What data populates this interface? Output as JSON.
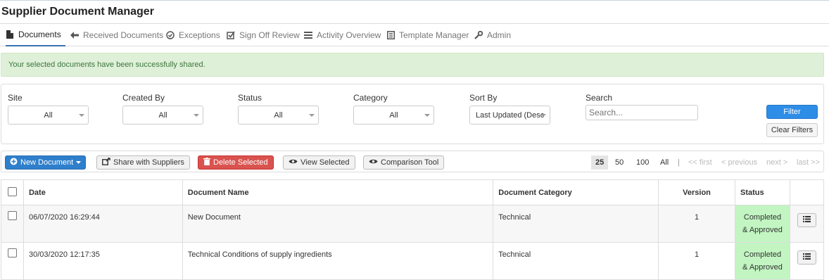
{
  "app": {
    "title": "Supplier Document Manager"
  },
  "tabs": [
    {
      "label": "Documents",
      "icon": "document-icon",
      "active": true
    },
    {
      "label": "Received Documents",
      "icon": "arrow-left-icon"
    },
    {
      "label": "Exceptions",
      "icon": "check-circle-icon"
    },
    {
      "label": "Sign Off Review",
      "icon": "check-square-icon"
    },
    {
      "label": "Activity Overview",
      "icon": "list-icon"
    },
    {
      "label": "Template Manager",
      "icon": "template-icon"
    },
    {
      "label": "Admin",
      "icon": "wrench-icon"
    }
  ],
  "alert": {
    "message": "Your selected documents have been successfully shared."
  },
  "filters": {
    "site": {
      "label": "Site",
      "value": "All"
    },
    "created_by": {
      "label": "Created By",
      "value": "All"
    },
    "status": {
      "label": "Status",
      "value": "All"
    },
    "category": {
      "label": "Category",
      "value": "All"
    },
    "sort_by": {
      "label": "Sort By",
      "value": "Last Updated (Desc"
    },
    "search": {
      "label": "Search",
      "placeholder": "Search..."
    },
    "filter_button": "Filter",
    "clear_button": "Clear Filters"
  },
  "toolbar": {
    "new_document": "New Document",
    "share": "Share with Suppliers",
    "delete": "Delete Selected",
    "view": "View Selected",
    "compare": "Comparison Tool"
  },
  "pager": {
    "sizes": [
      "25",
      "50",
      "100",
      "All"
    ],
    "separator": "|",
    "first": "<< first",
    "previous": "< previous",
    "next": "next >",
    "last": "last >>"
  },
  "table": {
    "columns": [
      "Date",
      "Document Name",
      "Document Category",
      "Version",
      "Status"
    ],
    "rows": [
      {
        "date": "06/07/2020 16:29:44",
        "name": "New Document",
        "category": "Technical",
        "version": "1",
        "status_line1": "Completed",
        "status_line2": "& Approved"
      },
      {
        "date": "30/03/2020 12:17:35",
        "name": "Technical Conditions of supply ingredients",
        "category": "Technical",
        "version": "1",
        "status_line1": "Completed",
        "status_line2": "& Approved"
      }
    ]
  },
  "colors": {
    "accent": "#2e7fcc",
    "success_bg": "#dff0d8",
    "status_bg": "#c2f5c2",
    "danger": "#d9534f"
  }
}
